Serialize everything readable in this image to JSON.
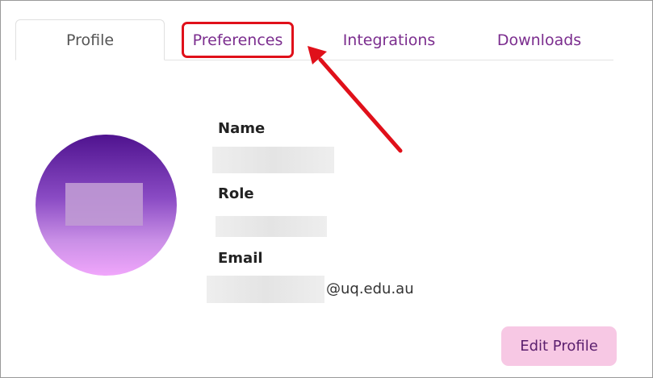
{
  "tabs": [
    {
      "label": "Profile",
      "active": true
    },
    {
      "label": "Preferences",
      "active": false
    },
    {
      "label": "Integrations",
      "active": false
    },
    {
      "label": "Downloads",
      "active": false
    }
  ],
  "profile": {
    "name_label": "Name",
    "role_label": "Role",
    "email_label": "Email",
    "email_domain": "@uq.edu.au"
  },
  "actions": {
    "edit_profile_label": "Edit Profile"
  },
  "annotation": {
    "highlight_color": "#e0101a"
  },
  "colors": {
    "tab_link": "#7b2d8e",
    "tab_active": "#555555",
    "button_bg": "#f7c8e4"
  }
}
